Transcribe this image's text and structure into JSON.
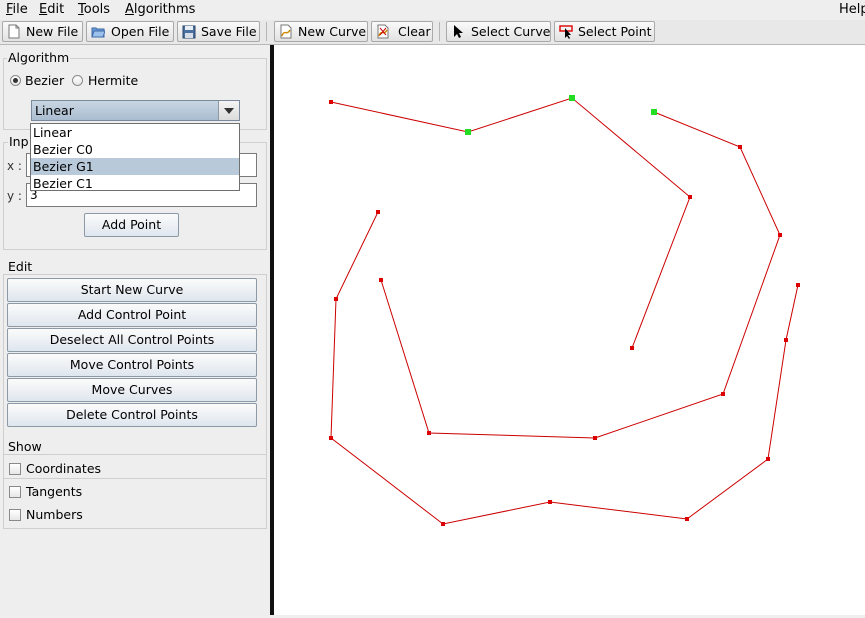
{
  "menu": {
    "file": {
      "mnemonic": "F",
      "rest": "ile"
    },
    "edit": {
      "mnemonic": "E",
      "rest": "dit"
    },
    "tools": {
      "mnemonic": "T",
      "rest": "ools"
    },
    "algorithms": {
      "mnemonic": "A",
      "rest": "lgorithms"
    },
    "help": "Help"
  },
  "toolbar": {
    "new_file": "New File",
    "open_file": "Open File",
    "save_file": "Save File",
    "new_curve": "New Curve",
    "clear": "Clear",
    "select_curve": "Select Curve",
    "select_point": "Select Point"
  },
  "algorithm": {
    "title": "Algorithm",
    "bezier": "Bezier",
    "hermite": "Hermite",
    "selected_radio": "Bezier",
    "combo_value": "Linear",
    "options": [
      "Linear",
      "Bezier C0",
      "Bezier G1",
      "Bezier C1"
    ],
    "highlighted_option": "Bezier G1"
  },
  "input": {
    "title": "Inp",
    "x_label": "x :",
    "y_label": "y :",
    "x_value": "",
    "y_value": "3",
    "add_point": "Add Point"
  },
  "edit": {
    "title": "Edit",
    "buttons": [
      "Start New Curve",
      "Add Control Point",
      "Deselect All Control Points",
      "Move Control Points",
      "Move Curves",
      "Delete Control Points"
    ]
  },
  "show": {
    "title": "Show",
    "coordinates": "Coordinates",
    "tangents": "Tangents",
    "numbers": "Numbers"
  },
  "colors": {
    "curve": "#cc0000",
    "point": "#dd0000",
    "selected_point": "#22dd22"
  },
  "curves": [
    {
      "points": [
        [
          57,
          57
        ],
        [
          194,
          87
        ],
        [
          298,
          53
        ],
        [
          416,
          152
        ],
        [
          358,
          303
        ]
      ],
      "selected": [
        1,
        2
      ]
    },
    {
      "points": [
        [
          380,
          67
        ],
        [
          466,
          102
        ],
        [
          506,
          190
        ],
        [
          449,
          349
        ],
        [
          321,
          393
        ],
        [
          155,
          388
        ],
        [
          107,
          235
        ]
      ],
      "selected": [
        0
      ]
    },
    {
      "points": [
        [
          104,
          167
        ],
        [
          62,
          254
        ],
        [
          57,
          393
        ],
        [
          169,
          479
        ],
        [
          276,
          457
        ],
        [
          413,
          474
        ],
        [
          494,
          414
        ],
        [
          512,
          295
        ],
        [
          524,
          240
        ]
      ],
      "selected": []
    }
  ]
}
